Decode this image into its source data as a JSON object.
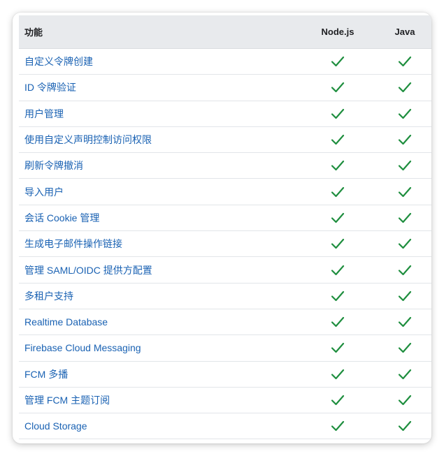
{
  "table": {
    "headers": {
      "feature": "功能",
      "nodejs": "Node.js",
      "java": "Java"
    },
    "rows": [
      {
        "feature": "自定义令牌创建",
        "nodejs": true,
        "java": true
      },
      {
        "feature": "ID 令牌验证",
        "nodejs": true,
        "java": true
      },
      {
        "feature": "用户管理",
        "nodejs": true,
        "java": true
      },
      {
        "feature": "使用自定义声明控制访问权限",
        "nodejs": true,
        "java": true
      },
      {
        "feature": "刷新令牌撤消",
        "nodejs": true,
        "java": true
      },
      {
        "feature": "导入用户",
        "nodejs": true,
        "java": true
      },
      {
        "feature": "会话 Cookie 管理",
        "nodejs": true,
        "java": true
      },
      {
        "feature": "生成电子邮件操作链接",
        "nodejs": true,
        "java": true
      },
      {
        "feature": "管理 SAML/OIDC 提供方配置",
        "nodejs": true,
        "java": true
      },
      {
        "feature": "多租户支持",
        "nodejs": true,
        "java": true
      },
      {
        "feature": "Realtime Database",
        "nodejs": true,
        "java": true
      },
      {
        "feature": "Firebase Cloud Messaging",
        "nodejs": true,
        "java": true
      },
      {
        "feature": "FCM 多播",
        "nodejs": true,
        "java": true
      },
      {
        "feature": "管理 FCM 主题订阅",
        "nodejs": true,
        "java": true
      },
      {
        "feature": "Cloud Storage",
        "nodejs": true,
        "java": true
      }
    ]
  },
  "icons": {
    "supported": "check-icon"
  },
  "colors": {
    "check": "#1e8e3e",
    "link": "#1a62b3",
    "header_bg": "#e8eaed"
  }
}
